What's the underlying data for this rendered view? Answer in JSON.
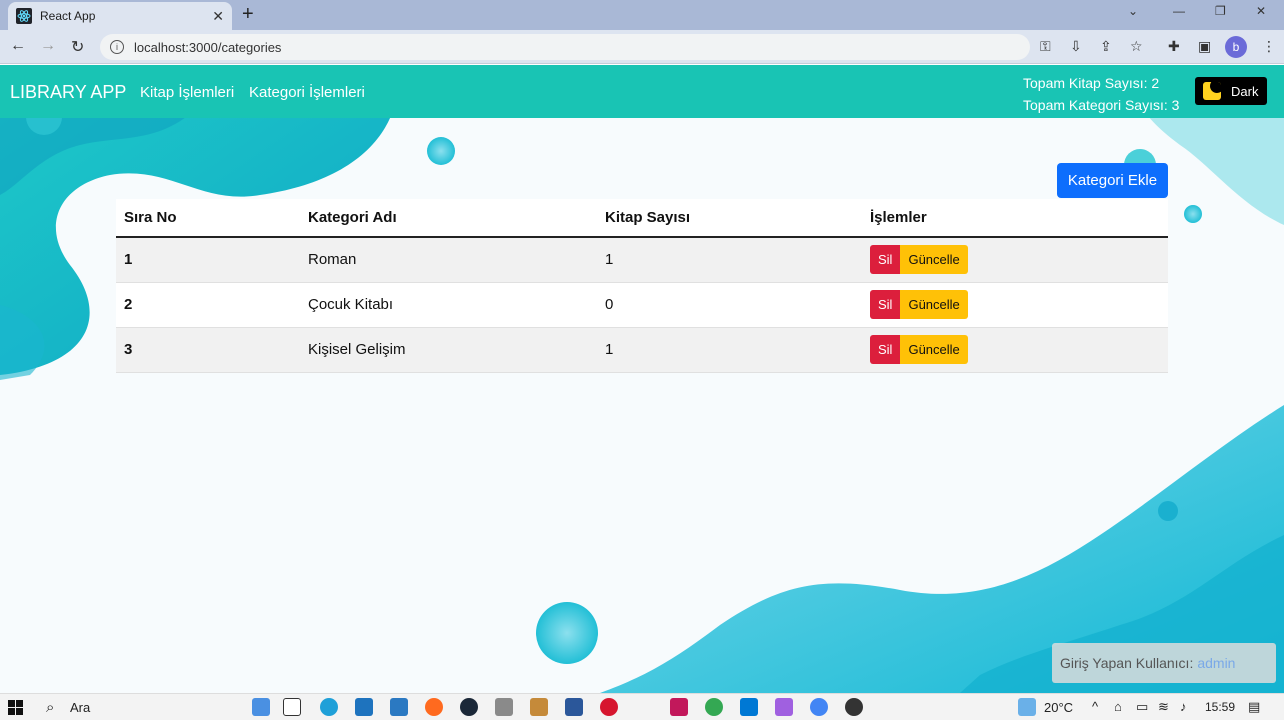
{
  "browser": {
    "tab_title": "React App",
    "url": "localhost:3000/categories",
    "profile_initial": "b"
  },
  "navbar": {
    "brand": "LIBRARY APP",
    "links": [
      "Kitap İşlemleri",
      "Kategori İşlemleri"
    ],
    "total_books": "Topam Kitap Sayısı: 2",
    "total_categories": "Topam Kategori Sayısı: 3",
    "theme_button": "Dark"
  },
  "main": {
    "add_button": "Kategori Ekle",
    "table": {
      "headers": [
        "Sıra No",
        "Kategori Adı",
        "Kitap Sayısı",
        "İşlemler"
      ],
      "rows": [
        {
          "no": "1",
          "name": "Roman",
          "count": "1",
          "delete": "Sil",
          "update": "Güncelle"
        },
        {
          "no": "2",
          "name": "Çocuk Kitabı",
          "count": "0",
          "delete": "Sil",
          "update": "Güncelle"
        },
        {
          "no": "3",
          "name": "Kişisel Gelişim",
          "count": "1",
          "delete": "Sil",
          "update": "Güncelle"
        }
      ]
    },
    "login_label": "Giriş Yapan Kullanıcı:",
    "login_user": "admin"
  },
  "taskbar": {
    "search": "Ara",
    "weather": "20°C",
    "time": "15:59"
  },
  "colors": {
    "navbar": "#19c4b4",
    "primary": "#0d6efd",
    "danger": "#dc1f3c",
    "warning": "#ffc107"
  }
}
